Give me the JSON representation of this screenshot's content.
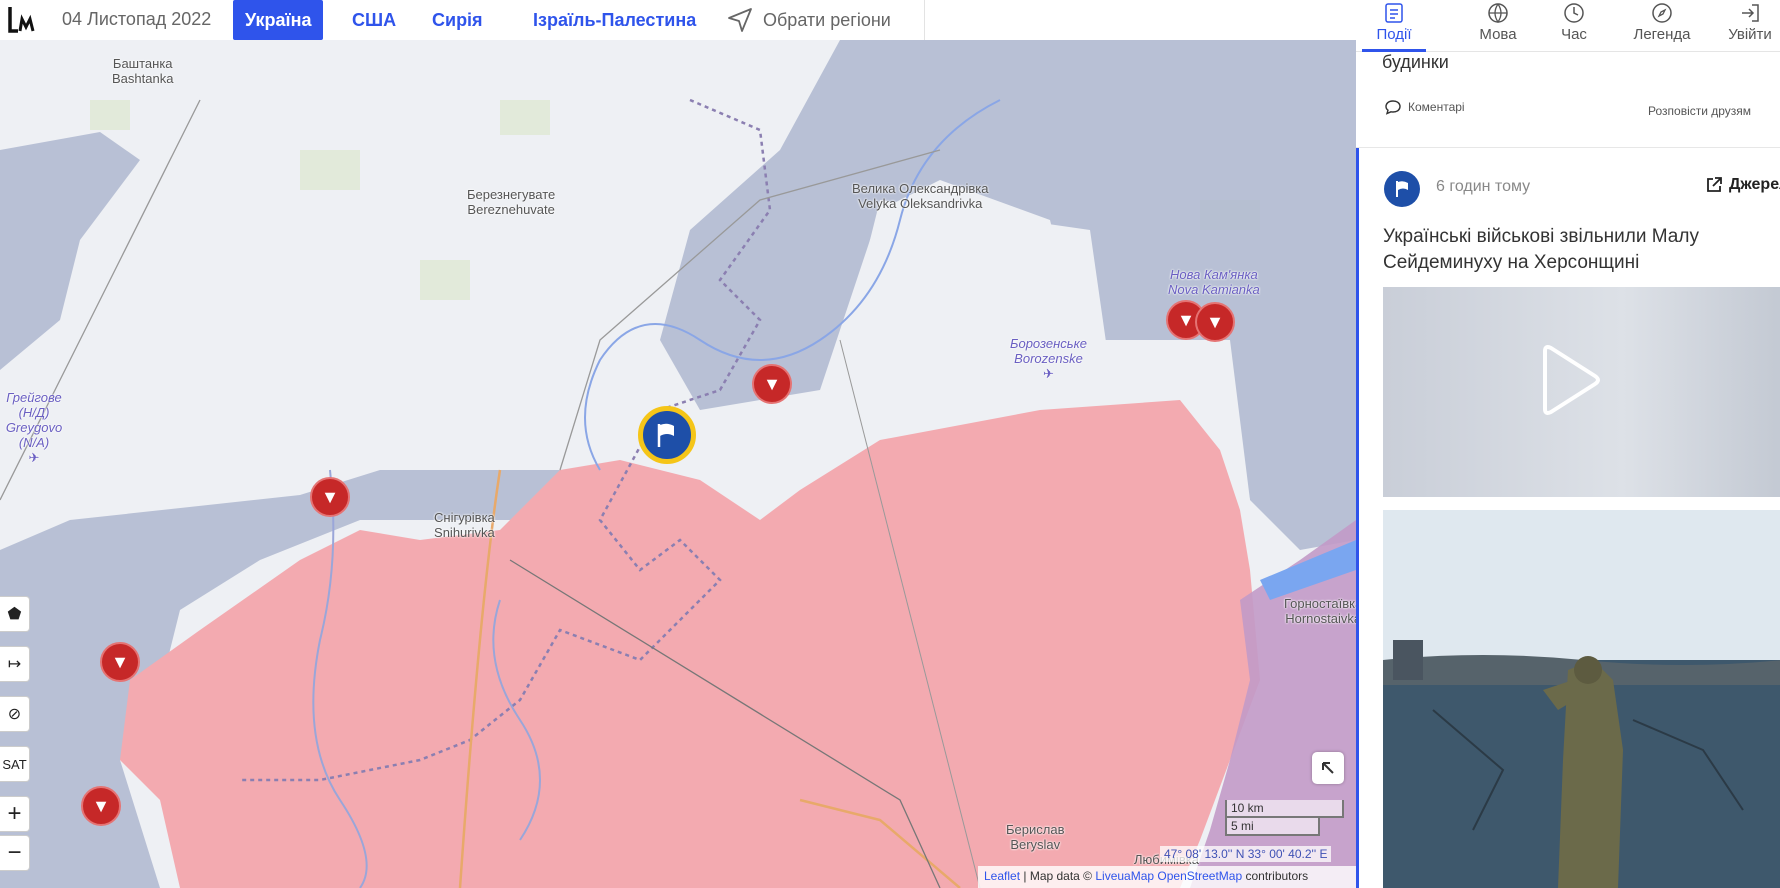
{
  "header": {
    "date": "04 Листопад 2022",
    "tabs": [
      {
        "label": "Україна",
        "active": true
      },
      {
        "label": "США",
        "active": false
      },
      {
        "label": "Сирія",
        "active": false
      },
      {
        "label": "Ізраїль-Палестина",
        "active": false
      }
    ],
    "select_regions": "Обрати регіони"
  },
  "panel_nav": [
    {
      "label": "Події",
      "icon": "events-list-icon",
      "active": true
    },
    {
      "label": "Мова",
      "icon": "globe-icon",
      "active": false
    },
    {
      "label": "Час",
      "icon": "clock-icon",
      "active": false
    },
    {
      "label": "Легенда",
      "icon": "compass-icon",
      "active": false
    },
    {
      "label": "Увійти",
      "icon": "login-icon",
      "active": false
    }
  ],
  "previous_card": {
    "title_tail": "будинки",
    "comments": "Коментарі",
    "share": "Розповісти друзям"
  },
  "event_card": {
    "time": "6 годин тому",
    "source": "Джерело",
    "title": "Українські військові звільнили Малу Сейдеминуху на Херсонщині"
  },
  "map": {
    "places": [
      {
        "line1": "Баштанка",
        "line2": "Bashtanka"
      },
      {
        "line1": "Березнегувате",
        "line2": "Bereznehuvate"
      },
      {
        "line1": "Велика Олександрівка",
        "line2": "Velyka Oleksandrivka"
      },
      {
        "line1": "Нова Кам'янка",
        "line2": "Nova Kamianka"
      },
      {
        "line1": "Борозенське",
        "line2": "Borozenske"
      },
      {
        "line1": "Грейгове (Н/Д)",
        "line2": "Greygovo (N/A)"
      },
      {
        "line1": "Снігурівка",
        "line2": "Snihurivka"
      },
      {
        "line1": "Горностаївка",
        "line2": "Hornostaivka"
      },
      {
        "line1": "Берислав",
        "line2": "Beryslav"
      },
      {
        "line1": "Любимівка",
        "line2": ""
      }
    ],
    "controls": {
      "sat": "SAT",
      "zoom_in": "+",
      "zoom_out": "−"
    },
    "scale": {
      "km": "10 km",
      "mi": "5 mi"
    },
    "coords": "47° 08' 13.0'' N 33° 00' 40.2'' E",
    "attribution": {
      "leaflet": "Leaflet",
      "sep": " | Map data © ",
      "livemap": "LiveuaMap",
      "osm": "OpenStreetMap",
      "tail": " contributors"
    },
    "colors": {
      "occupied": "#f3aab0",
      "liberated": "#aeb7cf",
      "water": "#7aa6f0",
      "background": "#eef0f4"
    }
  }
}
